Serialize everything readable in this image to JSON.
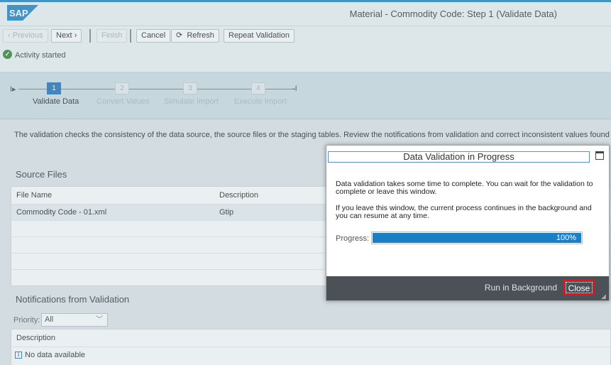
{
  "brand": {
    "logo_text": "SAP",
    "colors": {
      "accent": "#1a7fc4",
      "active_step": "#1a6db5",
      "close_highlight": "#e8141b"
    }
  },
  "header": {
    "title": "Material - Commodity Code: Step 1  (Validate Data)"
  },
  "toolbar": {
    "previous": "Previous",
    "next": "Next",
    "finish": "Finish",
    "cancel": "Cancel",
    "refresh": "Refresh",
    "repeat_validation": "Repeat Validation"
  },
  "message": {
    "icon": "success-check-icon",
    "text": "Activity started"
  },
  "roadmap": {
    "steps": [
      {
        "number": "1",
        "label": "Validate Data",
        "active": true
      },
      {
        "number": "2",
        "label": "Convert Values",
        "active": false
      },
      {
        "number": "3",
        "label": "Simulate Import",
        "active": false
      },
      {
        "number": "4",
        "label": "Execute Import",
        "active": false
      }
    ]
  },
  "main": {
    "description": "The validation checks the consistency of the data source, the source files or the staging tables. Review the notifications from validation and correct inconsistent values found in the data",
    "source_files": {
      "title": "Source Files",
      "columns": [
        "File Name",
        "Description"
      ],
      "rows": [
        {
          "file_name": "Commodity Code - 01.xml",
          "description": "Gtip"
        }
      ]
    },
    "notifications": {
      "title": "Notifications from Validation",
      "priority_label": "Priority:",
      "priority_value": "All",
      "column": "Description",
      "empty_text": "No data available"
    }
  },
  "dialog": {
    "title": "Data Validation in Progress",
    "paragraph1": "Data validation takes some time to complete. You can wait for the validation to complete or leave this window.",
    "paragraph2": "If you leave this window, the current process continues in the background and you can resume at any time.",
    "progress_label": "Progress:",
    "progress_value": 100,
    "progress_text": "100%",
    "run_in_background": "Run in Background",
    "close": "Close"
  }
}
